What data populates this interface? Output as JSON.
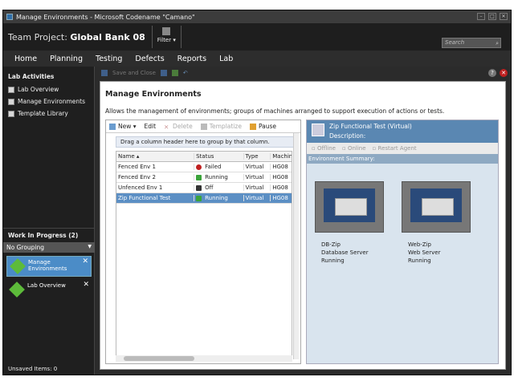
{
  "window": {
    "title": "Manage Environments - Microsoft Codename \"Camano\"",
    "min": "–",
    "max": "□",
    "close": "✕"
  },
  "project": {
    "prefix": "Team Project:",
    "name": "Global Bank 08",
    "filter": "Filter",
    "search_placeholder": "Search"
  },
  "nav": [
    "Home",
    "Planning",
    "Testing",
    "Defects",
    "Reports",
    "Lab"
  ],
  "sidebar": {
    "heading": "Lab Activities",
    "items": [
      "Lab Overview",
      "Manage Environments",
      "Template Library"
    ],
    "wip_heading": "Work In Progress (2)",
    "grouping": "No Grouping",
    "wip_items": [
      "Manage\nEnvironments",
      "Lab Overview"
    ],
    "unsaved": "Unsaved Items: 0"
  },
  "toolbar": {
    "save_close": "Save and Close"
  },
  "panel": {
    "title": "Manage Environments",
    "description": "Allows the management of environments; groups of machines arranged to support execution of actions or tests.",
    "actions": {
      "new": "New",
      "edit": "Edit",
      "delete": "Delete",
      "templatize": "Templatize",
      "pause": "Pause"
    },
    "group_hint": "Drag a column header here to group by that column.",
    "columns": [
      "Name",
      "Status",
      "Type",
      "Machin"
    ],
    "rows": [
      {
        "name": "Fenced Env 1",
        "status": "Failed",
        "type": "Virtual",
        "machine": "HG08"
      },
      {
        "name": "Fenced Env 2",
        "status": "Running",
        "type": "Virtual",
        "machine": "HG08"
      },
      {
        "name": "Unfenced Env 1",
        "status": "Off",
        "type": "Virtual",
        "machine": "HG08"
      },
      {
        "name": "Zip Functional Test",
        "status": "Running",
        "type": "Virtual",
        "machine": "HG08"
      }
    ]
  },
  "detail": {
    "title": "Zip Functional Test (Virtual)",
    "description_label": "Description:",
    "actions": {
      "offline": "Offline",
      "online": "Online",
      "restart": "Restart Agent"
    },
    "summary": "Environment Summary:",
    "vms": [
      {
        "name": "DB-Zip",
        "role": "Database Server",
        "status": "Running"
      },
      {
        "name": "Web-Zip",
        "role": "Web Server",
        "status": "Running"
      }
    ]
  },
  "colors": {
    "failed": "#c02020",
    "running": "#3aa33a",
    "off": "#333333",
    "selected": "#5c8fc4",
    "wip_selected": "#4b8cc7"
  }
}
